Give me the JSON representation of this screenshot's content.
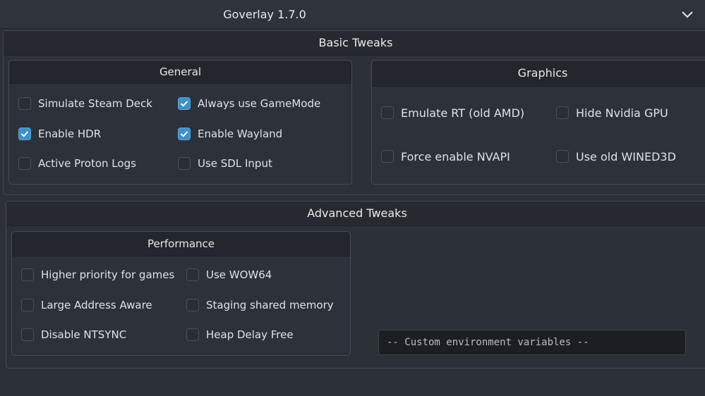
{
  "window": {
    "title": "Goverlay 1.7.0"
  },
  "basic": {
    "title": "Basic Tweaks",
    "general": {
      "title": "General",
      "items": [
        {
          "label": "Simulate Steam Deck",
          "checked": false
        },
        {
          "label": "Always use GameMode",
          "checked": true
        },
        {
          "label": "Enable HDR",
          "checked": true
        },
        {
          "label": "Enable Wayland",
          "checked": true
        },
        {
          "label": "Active Proton Logs",
          "checked": false
        },
        {
          "label": "Use SDL Input",
          "checked": false
        }
      ]
    },
    "graphics": {
      "title": "Graphics",
      "items": [
        {
          "label": "Emulate RT (old AMD)",
          "checked": false
        },
        {
          "label": "Hide Nvidia GPU",
          "checked": false
        },
        {
          "label": "Force enable NVAPI",
          "checked": false
        },
        {
          "label": "Use old WINED3D",
          "checked": false
        }
      ]
    }
  },
  "advanced": {
    "title": "Advanced Tweaks",
    "performance": {
      "title": "Performance",
      "items": [
        {
          "label": "Higher priority for games",
          "checked": false
        },
        {
          "label": "Use WOW64",
          "checked": false
        },
        {
          "label": "Large Address Aware",
          "checked": false
        },
        {
          "label": "Staging shared memory",
          "checked": false
        },
        {
          "label": "Disable NTSYNC",
          "checked": false
        },
        {
          "label": "Heap Delay Free",
          "checked": false
        }
      ]
    },
    "env_input": {
      "placeholder": "-- Custom environment variables --"
    }
  },
  "colors": {
    "accent": "#3f8fc8",
    "background": "#2c3138"
  }
}
